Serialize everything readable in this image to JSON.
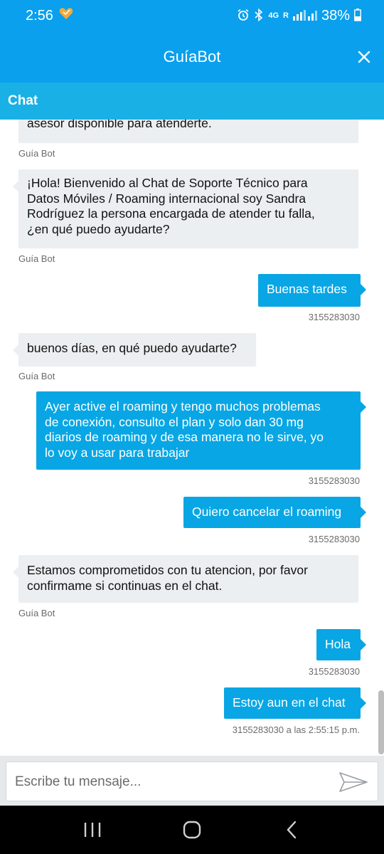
{
  "status_bar": {
    "time": "2:56",
    "network": "4G",
    "roaming": "R",
    "battery": "38%"
  },
  "app": {
    "title": "GuíaBot",
    "chat_label": "Chat"
  },
  "messages": [
    {
      "sender": "bot",
      "lines": [
        "asesor disponible para atenderte."
      ],
      "meta": "Guía Bot"
    },
    {
      "sender": "bot",
      "lines": [
        "¡Hola! Bienvenido al Chat de Soporte Técnico para",
        "Datos Móviles / Roaming internacional soy Sandra",
        "Rodríguez la persona encargada de atender tu falla,",
        "¿en qué puedo ayudarte?"
      ],
      "meta": "Guía Bot"
    },
    {
      "sender": "user",
      "lines": [
        "Buenas tardes"
      ],
      "meta": "3155283030"
    },
    {
      "sender": "bot",
      "lines": [
        "buenos días, en qué puedo ayudarte?"
      ],
      "meta": "Guía Bot"
    },
    {
      "sender": "user",
      "lines": [
        "Ayer active el roaming y tengo muchos problemas",
        "de conexión, consulto el plan y solo dan 30 mg",
        "diarios de roaming y de esa manera no le sirve, yo",
        "lo voy a usar para trabajar"
      ],
      "meta": "3155283030"
    },
    {
      "sender": "user",
      "lines": [
        "Quiero cancelar el roaming"
      ],
      "meta": "3155283030"
    },
    {
      "sender": "bot",
      "lines": [
        "Estamos comprometidos con tu atencion, por favor",
        "confirmame si continuas en el chat."
      ],
      "meta": "Guía Bot"
    },
    {
      "sender": "user",
      "lines": [
        "Hola"
      ],
      "meta": "3155283030"
    },
    {
      "sender": "user",
      "lines": [
        "Estoy aun en el chat"
      ],
      "meta": "3155283030 a las 2:55:15 p.m."
    }
  ],
  "input": {
    "placeholder": "Escribe tu mensaje...",
    "value": ""
  },
  "colors": {
    "header": "#0aa0ee",
    "chat_bar": "#19b0e6",
    "user_bubble": "#08a6e4",
    "bot_bubble": "#eceff1"
  }
}
